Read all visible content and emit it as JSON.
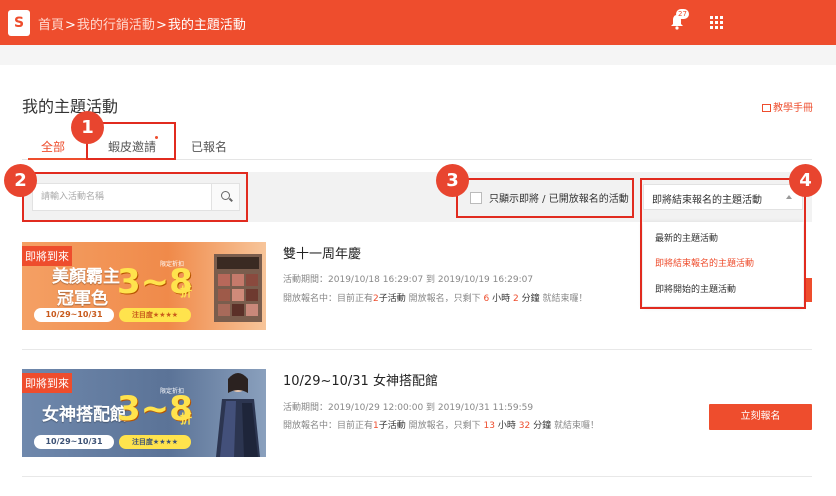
{
  "header": {
    "logo": "S",
    "crumb_home": "首頁",
    "sep1": ">",
    "crumb_marketing": "我的行銷活動",
    "sep2": ">",
    "crumb_current": "我的主題活動",
    "notification_count": "27"
  },
  "page": {
    "title": "我的主題活動",
    "manual_link": "教學手冊"
  },
  "tabs": [
    {
      "label": "全部",
      "active": true
    },
    {
      "label": "蝦皮邀請",
      "has_dot": true
    },
    {
      "label": "已報名"
    }
  ],
  "filters": {
    "search_placeholder": "請輸入活動名稱",
    "checkbox_label": "只顯示即將 / 已開放報名的活動",
    "sort_selected": "即將結束報名的主題活動",
    "sort_options": [
      {
        "label": "最新的主題活動"
      },
      {
        "label": "即將結束報名的主題活動",
        "selected": true
      },
      {
        "label": "即將開始的主題活動"
      }
    ]
  },
  "events": [
    {
      "banner": {
        "tag": "即將到來",
        "headline1": "美顏霸主",
        "headline2": "冠軍色",
        "big": "3~8",
        "small": "限定折扣",
        "zhe": "折",
        "date": "10/29~10/31",
        "note": "注目度★★★★"
      },
      "title": "雙十一周年慶",
      "period_label": "活動期間：",
      "period_value": "2019/10/18 16:29:07 到 2019/10/19 16:29:07",
      "status_prefix": "開放報名中：目前正有",
      "sub_count": "2",
      "sub_label": "子活動",
      "status_mid": "開放報名，只剩下",
      "hours": "6",
      "hours_label": "小時",
      "minutes": "2",
      "minutes_label": "分鐘",
      "status_end": "就結束囉！"
    },
    {
      "banner": {
        "tag": "即將到來",
        "headline1": "女神搭配館",
        "big": "3~8",
        "small": "限定折扣",
        "zhe": "折",
        "date": "10/29~10/31",
        "note": "注目度★★★★"
      },
      "title": "10/29~10/31 女神搭配館",
      "period_label": "活動期間：",
      "period_value": "2019/10/29 12:00:00 到 2019/10/31 11:59:59",
      "status_prefix": "開放報名中：目前正有",
      "sub_count": "1",
      "sub_label": "子活動",
      "status_mid": "開放報名，只剩下",
      "hours": "13",
      "hours_label": "小時",
      "minutes": "32",
      "minutes_label": "分鐘",
      "status_end": "就結束囉！",
      "button": "立刻報名"
    }
  ],
  "callouts": [
    "1",
    "2",
    "3",
    "4"
  ],
  "colors": {
    "brand": "#ee4d2d",
    "callout": "#e12b1f"
  }
}
